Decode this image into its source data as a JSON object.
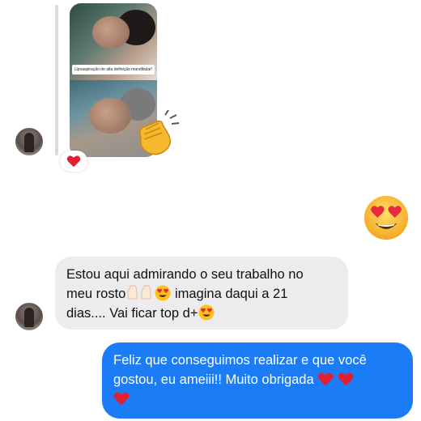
{
  "thread": {
    "shared_media": {
      "caption": "Lipoaspiração de alta definição mandibular!",
      "reaction": "heart-icon"
    },
    "sent_reaction": "heart-eyes-emoji",
    "incoming_message": {
      "line1": "Estou aqui admirando o seu trabalho no",
      "line2_a": "meu rosto",
      "line2_b": " imagina daqui a 21",
      "line3": "dias.... Vai ficar top d+"
    },
    "outgoing_message": {
      "line1": "Feliz que conseguimos realizar e que você",
      "line2": "gostou, eu ameiii!! Muito obrigada "
    }
  },
  "colors": {
    "incoming_bubble": "#ececee",
    "outgoing_bubble": "#1c7cf5",
    "heart": "#e0202e"
  }
}
